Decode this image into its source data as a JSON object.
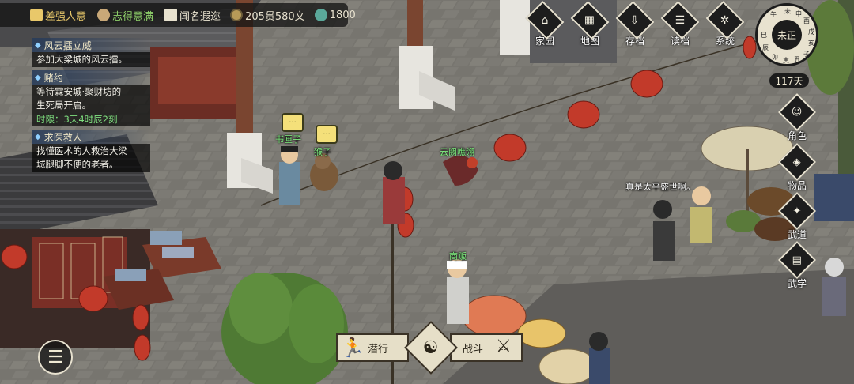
{
  "status_bar": {
    "items": [
      {
        "icon": "muscle-icon",
        "text": "差强人意",
        "color": "#e9c86a"
      },
      {
        "icon": "face-icon",
        "text": "志得意满",
        "color": "#8fd16a"
      },
      {
        "icon": "scroll-icon",
        "text": "闻名遐迩",
        "color": "#e8e2cf"
      },
      {
        "icon": "coin-icon",
        "text": "205贯580文",
        "color": "#e8e2cf"
      },
      {
        "icon": "jade-icon",
        "text": "1800",
        "color": "#e8e2cf"
      }
    ]
  },
  "quests": [
    {
      "title": "风云擂立威",
      "lines": [
        "参加大梁城的风云擂。"
      ],
      "limit": ""
    },
    {
      "title": "赌约",
      "lines": [
        "等待霖安城·聚财坊的",
        "生死局开启。"
      ],
      "limit": "时限：3天4时辰2刻"
    },
    {
      "title": "求医救人",
      "lines": [
        "找懂医术的人救治大梁",
        "城腿脚不便的老者。"
      ],
      "limit": ""
    }
  ],
  "top_menu": [
    {
      "label": "家园",
      "icon": "home-icon",
      "glyph": "⌂"
    },
    {
      "label": "地图",
      "icon": "map-icon",
      "glyph": "▦"
    },
    {
      "label": "存档",
      "icon": "save-icon",
      "glyph": "⇩"
    },
    {
      "label": "读档",
      "icon": "load-icon",
      "glyph": "☰"
    },
    {
      "label": "系统",
      "icon": "gear-icon",
      "glyph": "✲"
    }
  ],
  "clock": {
    "current": "未正",
    "ring": [
      "子",
      "丑",
      "寅",
      "卯",
      "辰",
      "巳",
      "午",
      "未",
      "申",
      "酉",
      "戌",
      "亥"
    ],
    "days": "117天"
  },
  "side_menu": [
    {
      "label": "角色",
      "icon": "character-icon",
      "glyph": "☺"
    },
    {
      "label": "物品",
      "icon": "bag-icon",
      "glyph": "◈"
    },
    {
      "label": "武道",
      "icon": "martial-icon",
      "glyph": "✦"
    },
    {
      "label": "武学",
      "icon": "book-icon",
      "glyph": "▤"
    }
  ],
  "npcs": [
    {
      "name": "书匣子",
      "bubble": "..."
    },
    {
      "name": "猴子",
      "bubble": "..."
    },
    {
      "name": "云阙噍翎",
      "bubble": ""
    },
    {
      "name": "商贩",
      "bubble": ""
    }
  ],
  "speech": "真是太平盛世啊。",
  "actions": [
    {
      "label": "潜行",
      "icon": "sneak-icon"
    },
    {
      "label": "meditate",
      "icon": "meditate-icon"
    },
    {
      "label": "战斗",
      "icon": "sword-icon"
    }
  ],
  "menu_button": {
    "icon": "hamburger-icon",
    "glyph": "☰"
  }
}
